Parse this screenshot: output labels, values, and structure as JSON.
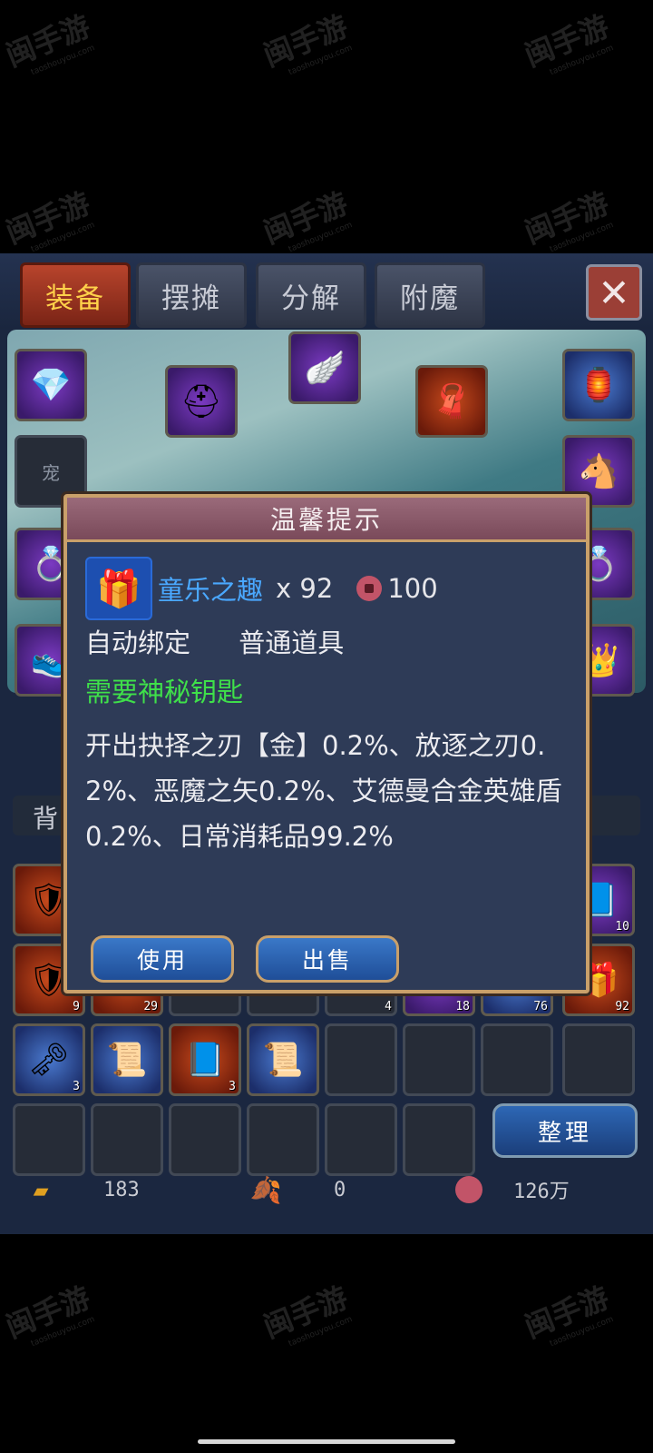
{
  "tabs": [
    "装备",
    "摆摊",
    "分解",
    "附魔"
  ],
  "close_icon": "close-icon",
  "pet_slot_label": "宠",
  "bag_tab_label": "背",
  "sort_button": "整理",
  "currency": {
    "gold": "183",
    "leaf": "0",
    "coin": "126万"
  },
  "slot_counts": {
    "r2_1": "9",
    "r2_2": "29",
    "r2_5": "4",
    "r2_6": "18",
    "r2_7": "76",
    "r2_8": "92",
    "r1_8": "10",
    "r3_1": "3",
    "r3_3": "3"
  },
  "dialog": {
    "title": "温馨提示",
    "item_name": "童乐之趣",
    "item_qty": "x 92",
    "item_price": "100",
    "bind_type": "自动绑定",
    "item_type": "普通道具",
    "requirement": "需要神秘钥匙",
    "description": "开出抉择之刃【金】0.2%、放逐之刃0.2%、恶魔之矢0.2%、艾德曼合金英雄盾0.2%、日常消耗品99.2%",
    "use_button": "使用",
    "sell_button": "出售"
  },
  "colors": {
    "item_name": "#4aa8ff",
    "requirement": "#3fe04a",
    "active_tab_text": "#ffd24a"
  }
}
